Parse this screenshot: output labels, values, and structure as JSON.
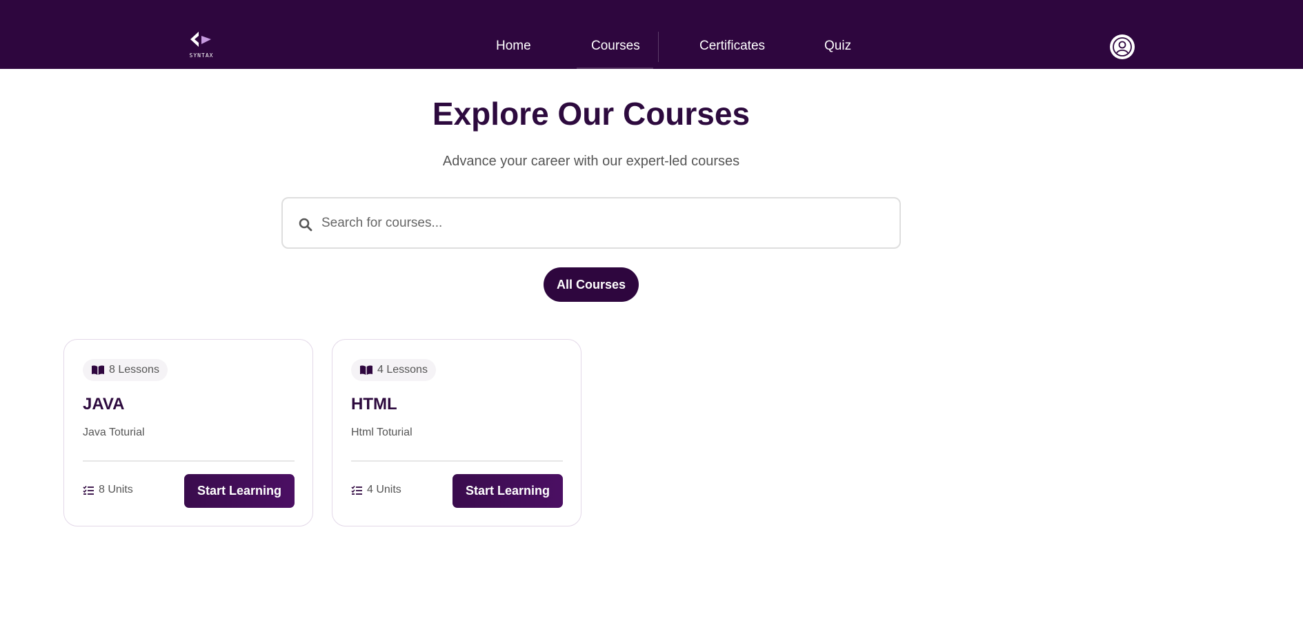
{
  "brand": {
    "logo_text": "SYNTAX"
  },
  "nav": {
    "items": [
      {
        "label": "Home"
      },
      {
        "label": "Courses"
      },
      {
        "label": "Certificates"
      },
      {
        "label": "Quiz"
      }
    ]
  },
  "hero": {
    "title": "Explore Our Courses",
    "subtitle": "Advance your career with our expert-led courses"
  },
  "search": {
    "placeholder": "Search for courses..."
  },
  "filter": {
    "label": "All Courses"
  },
  "courses": [
    {
      "lessons": "8 Lessons",
      "title": "JAVA",
      "description": "Java Toturial",
      "units": "8 Units",
      "button": "Start Learning"
    },
    {
      "lessons": "4 Lessons",
      "title": "HTML",
      "description": "Html Toturial",
      "units": "4 Units",
      "button": "Start Learning"
    }
  ],
  "colors": {
    "primary": "#2e063e",
    "background": "#ffffff",
    "muted_text": "#555555"
  },
  "icons": {
    "logo": "code-brackets-icon",
    "avatar": "user-circle-icon",
    "search": "search-icon",
    "lessons": "book-open-icon",
    "units": "list-check-icon"
  }
}
